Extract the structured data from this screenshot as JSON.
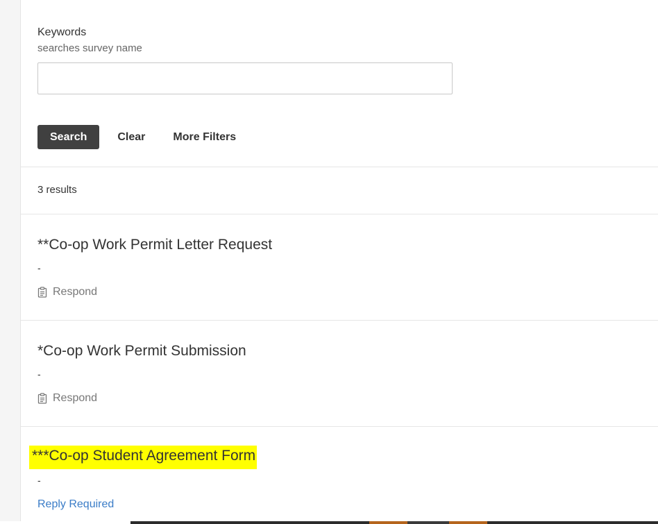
{
  "filters": {
    "keywords_label": "Keywords",
    "keywords_hint": "searches survey name",
    "keywords_value": "",
    "keywords_placeholder": ""
  },
  "buttons": {
    "search": "Search",
    "clear": "Clear",
    "more_filters": "More Filters"
  },
  "results": {
    "count_text": "3 results",
    "items": [
      {
        "title": "**Co-op Work Permit Letter Request",
        "description": "-",
        "action": "Respond",
        "action_icon": "clipboard-icon"
      },
      {
        "title": "*Co-op Work Permit Submission",
        "description": "-",
        "action": "Respond",
        "action_icon": "clipboard-icon"
      },
      {
        "title": "***Co-op Student Agreement Form",
        "description": "-",
        "action": "Reply Required",
        "highlighted": true
      }
    ]
  },
  "colors": {
    "search_button_bg": "#404040",
    "link_blue": "#3a7cc7",
    "highlight": "#ffff00"
  }
}
